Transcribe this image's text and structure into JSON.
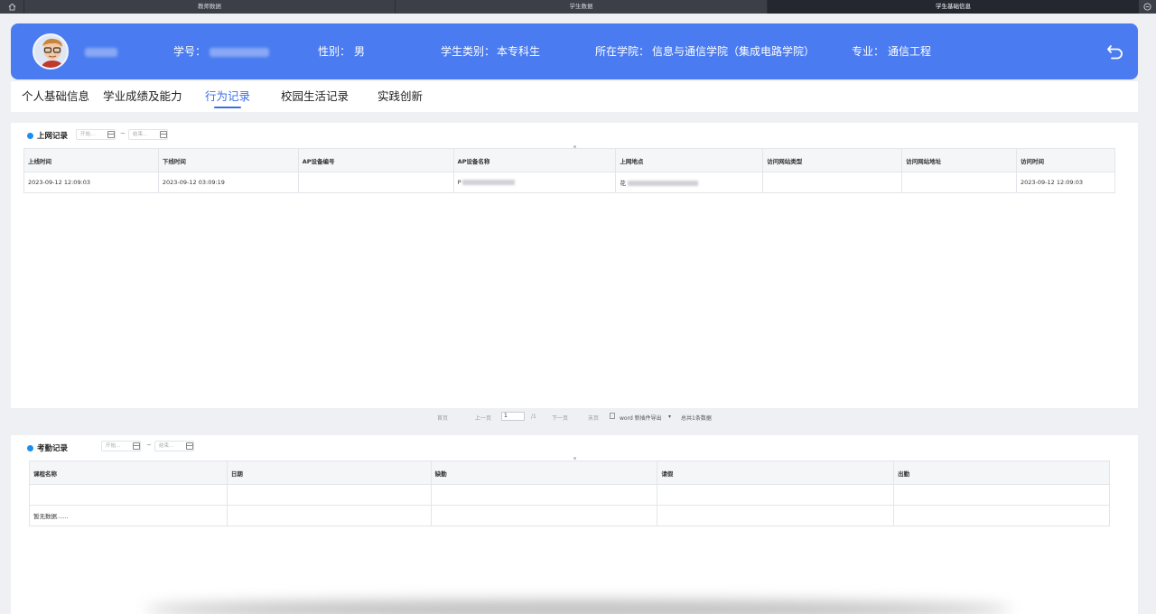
{
  "topbar": {
    "tabs": [
      "教师数据",
      "学生数据",
      "学生基础信息"
    ]
  },
  "profile": {
    "student_id_label": "学号：",
    "gender_label": "性别：",
    "gender_value": "男",
    "category_label": "学生类别：",
    "category_value": "本专科生",
    "college_label": "所在学院：",
    "college_value": "信息与通信学院（集成电路学院）",
    "major_label": "专业：",
    "major_value": "通信工程"
  },
  "subtabs": [
    "个人基础信息",
    "学业成绩及能力",
    "行为记录",
    "校园生活记录",
    "实践创新"
  ],
  "internet": {
    "title": "上网记录",
    "start_placeholder": "开始...",
    "end_placeholder": "结束...",
    "tilde": "~",
    "columns": [
      "上线时间",
      "下线时间",
      "AP设备编号",
      "AP设备名称",
      "上网地点",
      "访问网站类型",
      "访问网站地址",
      "访问时间"
    ],
    "row": {
      "online": "2023-09-12 12:09:03",
      "offline": "2023-09-12 03:09:19",
      "ap_id": "",
      "ap_name_prefix": "P",
      "location_prefix": "花",
      "site_type": "",
      "site_url": "",
      "visit_time": "2023-09-12 12:09:03"
    }
  },
  "pager": {
    "first": "首页",
    "prev": "上一页",
    "page": "1",
    "total_pages": "/1",
    "next": "下一页",
    "last": "末页",
    "export": "word 新插件导出",
    "summary": "总共1条数据"
  },
  "attendance": {
    "title": "考勤记录",
    "start_placeholder": "开始...",
    "end_placeholder": "结束...",
    "tilde": "~",
    "columns": [
      "课程名称",
      "日期",
      "缺勤",
      "请假",
      "出勤"
    ],
    "empty_text": "暂无数据......"
  },
  "colors": {
    "header_blue": "#4a7bf0",
    "active_tab": "#3b6fe6",
    "dot_blue": "#1a8ff0"
  }
}
